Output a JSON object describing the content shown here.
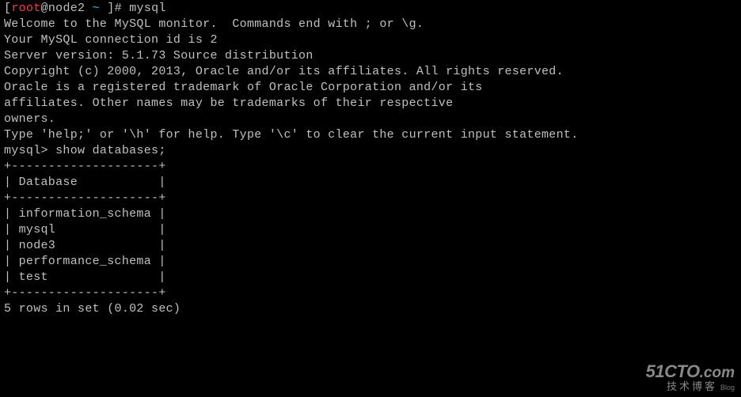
{
  "prompt": {
    "bracket_open": "[",
    "user": "root",
    "at": "@",
    "host": "node2",
    "path": "~",
    "bracket_close": "]#",
    "command": "mysql"
  },
  "welcome": [
    "Welcome to the MySQL monitor.  Commands end with ; or \\g.",
    "Your MySQL connection id is 2",
    "Server version: 5.1.73 Source distribution",
    "",
    "Copyright (c) 2000, 2013, Oracle and/or its affiliates. All rights reserved.",
    "",
    "Oracle is a registered trademark of Oracle Corporation and/or its",
    "affiliates. Other names may be trademarks of their respective",
    "owners.",
    "",
    "Type 'help;' or '\\h' for help. Type '\\c' to clear the current input statement.",
    ""
  ],
  "mysql_prompt": {
    "label": "mysql>",
    "command": "show databases;"
  },
  "table": {
    "border": "+--------------------+",
    "header": "| Database           |",
    "rows": [
      "| information_schema |",
      "| mysql              |",
      "| node3              |",
      "| performance_schema |",
      "| test               |"
    ],
    "databases": [
      "information_schema",
      "mysql",
      "node3",
      "performance_schema",
      "test"
    ]
  },
  "result": "5 rows in set (0.02 sec)",
  "watermark": {
    "brand_left": "51CTO",
    "brand_right": ".com",
    "sub": "技术博客",
    "tiny": "Blog"
  }
}
